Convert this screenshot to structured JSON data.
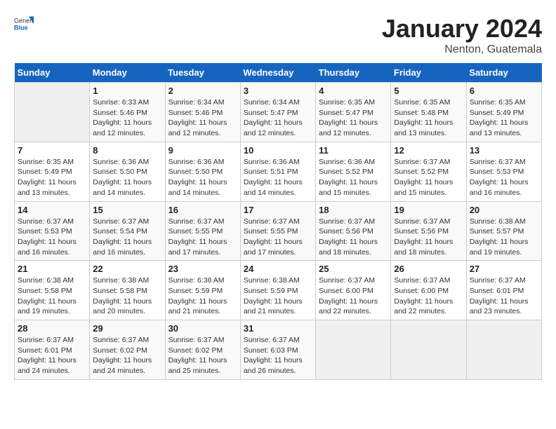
{
  "header": {
    "logo_general": "General",
    "logo_blue": "Blue",
    "title": "January 2024",
    "subtitle": "Nenton, Guatemala"
  },
  "calendar": {
    "days_of_week": [
      "Sunday",
      "Monday",
      "Tuesday",
      "Wednesday",
      "Thursday",
      "Friday",
      "Saturday"
    ],
    "weeks": [
      [
        {
          "day": "",
          "info": ""
        },
        {
          "day": "1",
          "info": "Sunrise: 6:33 AM\nSunset: 5:46 PM\nDaylight: 11 hours and 12 minutes."
        },
        {
          "day": "2",
          "info": "Sunrise: 6:34 AM\nSunset: 5:46 PM\nDaylight: 11 hours and 12 minutes."
        },
        {
          "day": "3",
          "info": "Sunrise: 6:34 AM\nSunset: 5:47 PM\nDaylight: 11 hours and 12 minutes."
        },
        {
          "day": "4",
          "info": "Sunrise: 6:35 AM\nSunset: 5:47 PM\nDaylight: 11 hours and 12 minutes."
        },
        {
          "day": "5",
          "info": "Sunrise: 6:35 AM\nSunset: 5:48 PM\nDaylight: 11 hours and 13 minutes."
        },
        {
          "day": "6",
          "info": "Sunrise: 6:35 AM\nSunset: 5:49 PM\nDaylight: 11 hours and 13 minutes."
        }
      ],
      [
        {
          "day": "7",
          "info": "Sunrise: 6:35 AM\nSunset: 5:49 PM\nDaylight: 11 hours and 13 minutes."
        },
        {
          "day": "8",
          "info": "Sunrise: 6:36 AM\nSunset: 5:50 PM\nDaylight: 11 hours and 14 minutes."
        },
        {
          "day": "9",
          "info": "Sunrise: 6:36 AM\nSunset: 5:50 PM\nDaylight: 11 hours and 14 minutes."
        },
        {
          "day": "10",
          "info": "Sunrise: 6:36 AM\nSunset: 5:51 PM\nDaylight: 11 hours and 14 minutes."
        },
        {
          "day": "11",
          "info": "Sunrise: 6:36 AM\nSunset: 5:52 PM\nDaylight: 11 hours and 15 minutes."
        },
        {
          "day": "12",
          "info": "Sunrise: 6:37 AM\nSunset: 5:52 PM\nDaylight: 11 hours and 15 minutes."
        },
        {
          "day": "13",
          "info": "Sunrise: 6:37 AM\nSunset: 5:53 PM\nDaylight: 11 hours and 16 minutes."
        }
      ],
      [
        {
          "day": "14",
          "info": "Sunrise: 6:37 AM\nSunset: 5:53 PM\nDaylight: 11 hours and 16 minutes."
        },
        {
          "day": "15",
          "info": "Sunrise: 6:37 AM\nSunset: 5:54 PM\nDaylight: 11 hours and 16 minutes."
        },
        {
          "day": "16",
          "info": "Sunrise: 6:37 AM\nSunset: 5:55 PM\nDaylight: 11 hours and 17 minutes."
        },
        {
          "day": "17",
          "info": "Sunrise: 6:37 AM\nSunset: 5:55 PM\nDaylight: 11 hours and 17 minutes."
        },
        {
          "day": "18",
          "info": "Sunrise: 6:37 AM\nSunset: 5:56 PM\nDaylight: 11 hours and 18 minutes."
        },
        {
          "day": "19",
          "info": "Sunrise: 6:37 AM\nSunset: 5:56 PM\nDaylight: 11 hours and 18 minutes."
        },
        {
          "day": "20",
          "info": "Sunrise: 6:38 AM\nSunset: 5:57 PM\nDaylight: 11 hours and 19 minutes."
        }
      ],
      [
        {
          "day": "21",
          "info": "Sunrise: 6:38 AM\nSunset: 5:58 PM\nDaylight: 11 hours and 19 minutes."
        },
        {
          "day": "22",
          "info": "Sunrise: 6:38 AM\nSunset: 5:58 PM\nDaylight: 11 hours and 20 minutes."
        },
        {
          "day": "23",
          "info": "Sunrise: 6:38 AM\nSunset: 5:59 PM\nDaylight: 11 hours and 21 minutes."
        },
        {
          "day": "24",
          "info": "Sunrise: 6:38 AM\nSunset: 5:59 PM\nDaylight: 11 hours and 21 minutes."
        },
        {
          "day": "25",
          "info": "Sunrise: 6:37 AM\nSunset: 6:00 PM\nDaylight: 11 hours and 22 minutes."
        },
        {
          "day": "26",
          "info": "Sunrise: 6:37 AM\nSunset: 6:00 PM\nDaylight: 11 hours and 22 minutes."
        },
        {
          "day": "27",
          "info": "Sunrise: 6:37 AM\nSunset: 6:01 PM\nDaylight: 11 hours and 23 minutes."
        }
      ],
      [
        {
          "day": "28",
          "info": "Sunrise: 6:37 AM\nSunset: 6:01 PM\nDaylight: 11 hours and 24 minutes."
        },
        {
          "day": "29",
          "info": "Sunrise: 6:37 AM\nSunset: 6:02 PM\nDaylight: 11 hours and 24 minutes."
        },
        {
          "day": "30",
          "info": "Sunrise: 6:37 AM\nSunset: 6:02 PM\nDaylight: 11 hours and 25 minutes."
        },
        {
          "day": "31",
          "info": "Sunrise: 6:37 AM\nSunset: 6:03 PM\nDaylight: 11 hours and 26 minutes."
        },
        {
          "day": "",
          "info": ""
        },
        {
          "day": "",
          "info": ""
        },
        {
          "day": "",
          "info": ""
        }
      ]
    ]
  }
}
